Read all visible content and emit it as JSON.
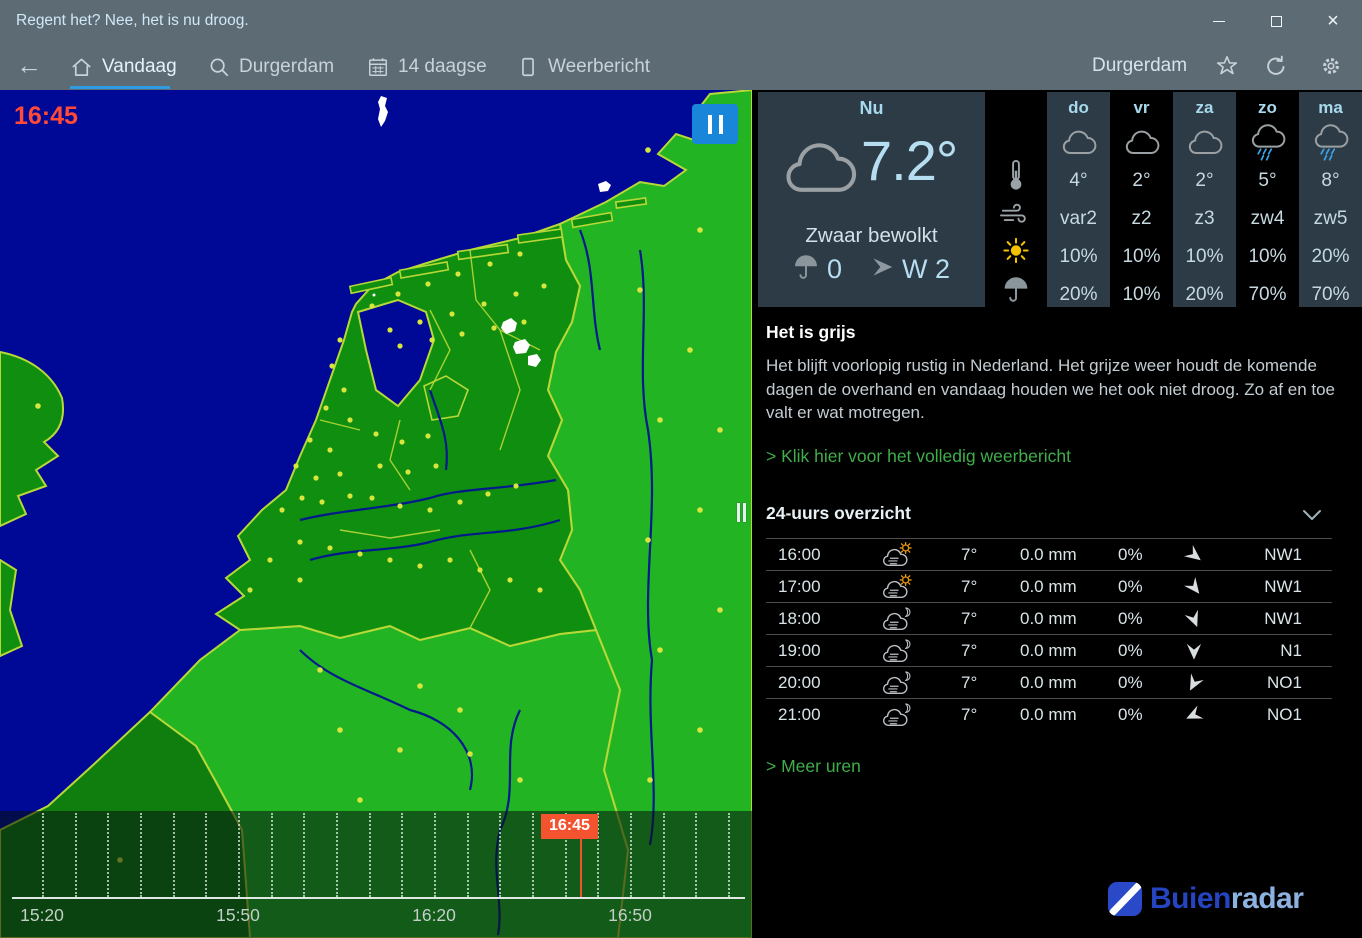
{
  "titlebar": {
    "title": "Regent het? Nee, het is nu droog.",
    "close_glyph": "×"
  },
  "nav": {
    "back_glyph": "←",
    "items": [
      {
        "label": "Vandaag",
        "icon": "home-icon",
        "active": true
      },
      {
        "label": "Durgerdam",
        "icon": "search-icon",
        "active": false
      },
      {
        "label": "14 daagse",
        "icon": "calendar-icon",
        "active": false
      },
      {
        "label": "Weerbericht",
        "icon": "document-icon",
        "active": false
      }
    ],
    "location": "Durgerdam"
  },
  "map": {
    "timestamp": "16:45",
    "pause_icon": "pause-icon",
    "timeline": {
      "labels": [
        "15:20",
        "15:50",
        "16:20",
        "16:50"
      ],
      "marker": "16:45"
    }
  },
  "now": {
    "title": "Nu",
    "icon": "cloud-icon",
    "temperature": "7.2°",
    "condition": "Zwaar bewolkt",
    "precipitation": "0",
    "wind": "W 2"
  },
  "metrics": [
    "thermometer-icon",
    "wind-icon",
    "sun-icon",
    "umbrella-icon"
  ],
  "forecast": {
    "days": [
      {
        "label": "do",
        "icon": "cloud",
        "temp": "4°",
        "wind": "var2",
        "sun": "10%",
        "rain": "20%"
      },
      {
        "label": "vr",
        "icon": "cloud",
        "temp": "2°",
        "wind": "z2",
        "sun": "10%",
        "rain": "10%"
      },
      {
        "label": "za",
        "icon": "cloud",
        "temp": "2°",
        "wind": "z3",
        "sun": "10%",
        "rain": "20%"
      },
      {
        "label": "zo",
        "icon": "rain-cloud",
        "temp": "5°",
        "wind": "zw4",
        "sun": "10%",
        "rain": "70%"
      },
      {
        "label": "ma",
        "icon": "rain-cloud",
        "temp": "8°",
        "wind": "zw5",
        "sun": "20%",
        "rain": "70%"
      }
    ]
  },
  "report": {
    "heading": "Het is grijs",
    "body": "Het blijft voorlopig rustig in Nederland. Het grijze weer houdt de komende dagen de overhand en vandaag houden we het ook niet droog. Zo af en toe valt er wat motregen.",
    "link": "> Klik hier voor het volledig weerbericht"
  },
  "hours": {
    "heading": "24-uurs overzicht",
    "rows": [
      {
        "time": "16:00",
        "icon": "sun-cloud",
        "temp": "7°",
        "precip": "0.0 mm",
        "chance": "0%",
        "wind": "NW1"
      },
      {
        "time": "17:00",
        "icon": "sun-cloud",
        "temp": "7°",
        "precip": "0.0 mm",
        "chance": "0%",
        "wind": "NW1"
      },
      {
        "time": "18:00",
        "icon": "moon-cloud",
        "temp": "7°",
        "precip": "0.0 mm",
        "chance": "0%",
        "wind": "NW1"
      },
      {
        "time": "19:00",
        "icon": "moon-cloud",
        "temp": "7°",
        "precip": "0.0 mm",
        "chance": "0%",
        "wind": "N1"
      },
      {
        "time": "20:00",
        "icon": "moon-cloud",
        "temp": "7°",
        "precip": "0.0 mm",
        "chance": "0%",
        "wind": "NO1"
      },
      {
        "time": "21:00",
        "icon": "moon-cloud",
        "temp": "7°",
        "precip": "0.0 mm",
        "chance": "0%",
        "wind": "NO1"
      }
    ],
    "more_link": "> Meer uren"
  },
  "logo": {
    "part1": "Buien",
    "part2": "radar"
  },
  "colors": {
    "accent_blue": "#2f9be0",
    "marker_orange": "#f45330",
    "link_green": "#3fae49",
    "panel_slate": "#2c3b45",
    "sea_blue": "#000896",
    "land_green": "#0f8e0f",
    "land_bright_green": "#22b422",
    "now_text_blue": "#b6ddf0"
  }
}
